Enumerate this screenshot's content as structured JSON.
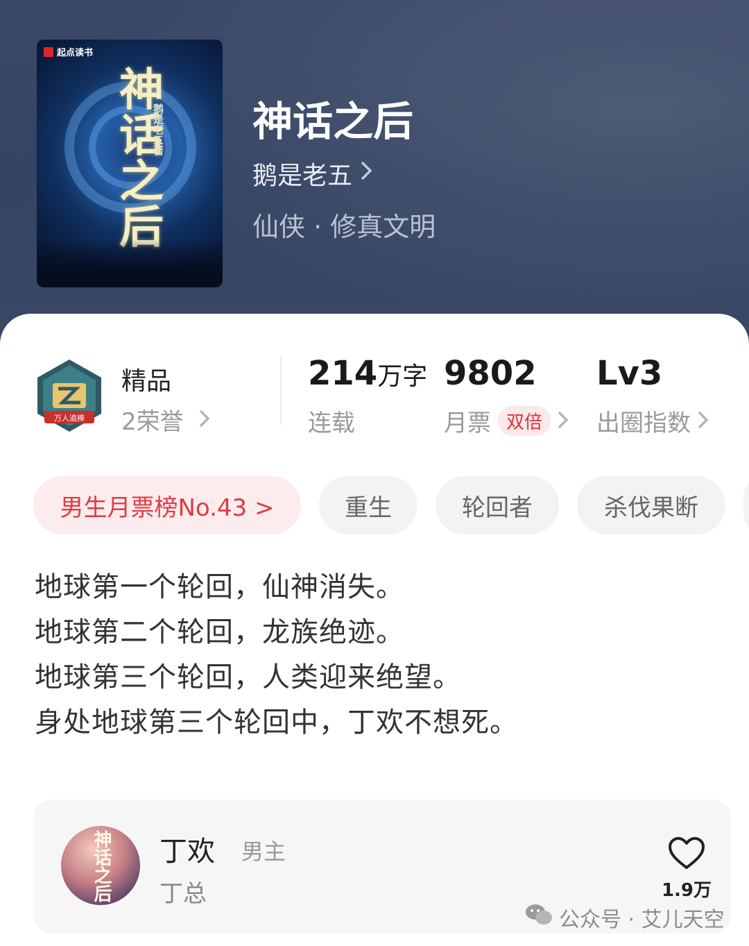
{
  "book": {
    "title": "神话之后",
    "author": "鹅是老五",
    "author_chevron": ">",
    "genre": "仙侠 · 修真文明",
    "cover": {
      "brand": "起点读书",
      "title": "神话之后",
      "author": "鹅是老五著"
    }
  },
  "stats": {
    "honor": {
      "title": "精品",
      "sub": "2荣誉",
      "badge_text": "万人追捧"
    },
    "words": {
      "value": "214",
      "unit": "万字",
      "label": "连载"
    },
    "tickets": {
      "value": "9802",
      "label": "月票",
      "tag": "双倍"
    },
    "level": {
      "value": "Lv3",
      "label": "出圈指数"
    },
    "chevron": ">"
  },
  "tags": [
    {
      "label": "男生月票榜No.43 >",
      "type": "rank"
    },
    {
      "label": "重生",
      "type": "normal"
    },
    {
      "label": "轮回者",
      "type": "normal"
    },
    {
      "label": "杀伐果断",
      "type": "normal"
    }
  ],
  "description": [
    "地球第一个轮回，仙神消失。",
    "地球第二个轮回，龙族绝迹。",
    "地球第三个轮回，人类迎来绝望。",
    "身处地球第三个轮回中，丁欢不想死。"
  ],
  "character": {
    "name": "丁欢",
    "role": "男主",
    "nickname": "丁总",
    "likes": "1.9万",
    "avatar_text": "神话之后"
  },
  "watermark": "公众号 · 艾儿天空",
  "colors": {
    "accent": "#e03a45",
    "header_bg": "#354463"
  },
  "icons": {
    "like": "heart-outline-icon",
    "chevron": "chevron-right-icon",
    "wechat": "wechat-icon"
  }
}
